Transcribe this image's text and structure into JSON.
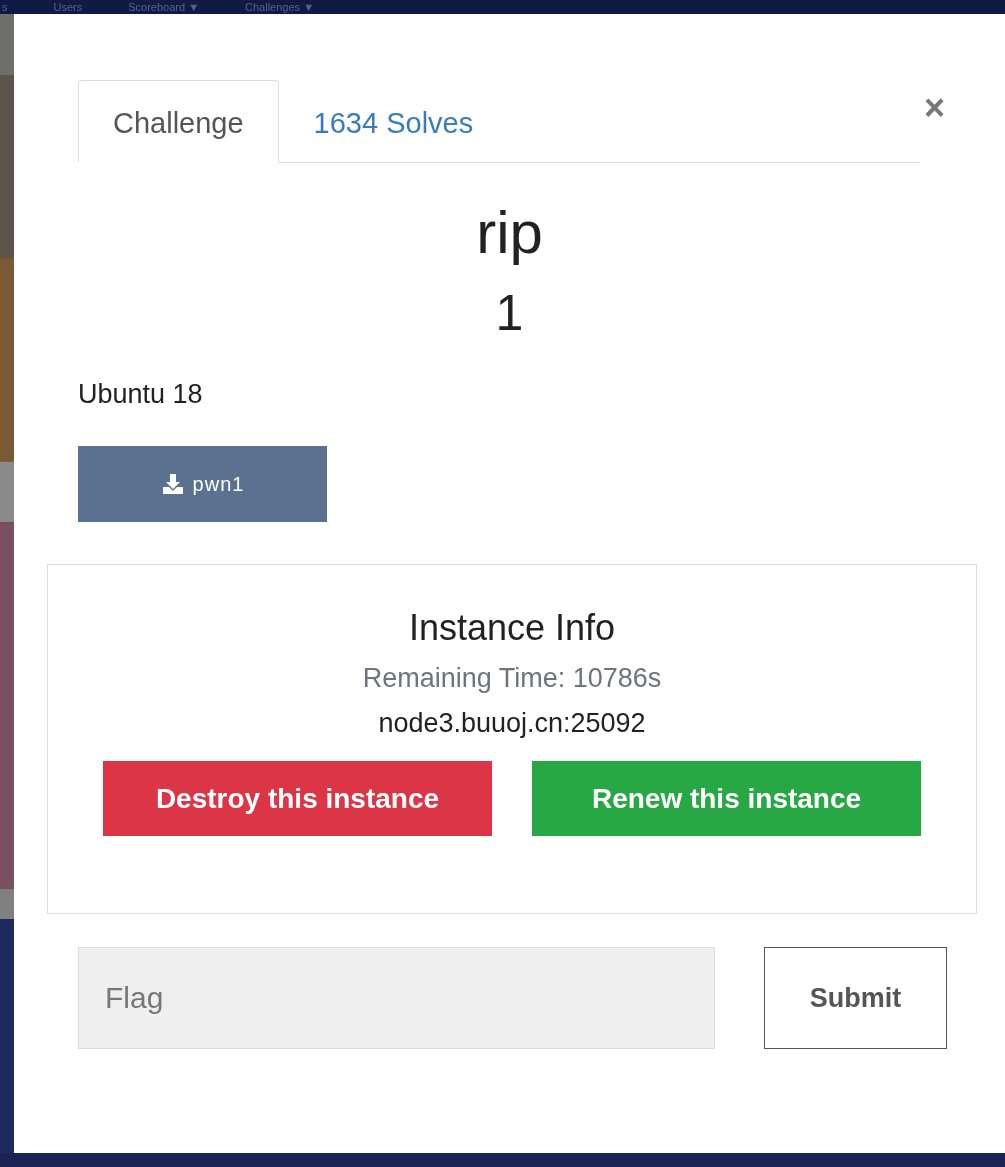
{
  "nav": {
    "items": [
      "s",
      "Users",
      "Scoreboard ▼",
      "Challenges ▼"
    ]
  },
  "tabs": [
    {
      "label": "Challenge",
      "selected": true
    },
    {
      "label": "1634 Solves",
      "selected": false
    }
  ],
  "close": "×",
  "challenge": {
    "name": "rip",
    "value": "1",
    "description": "Ubuntu 18",
    "files": [
      {
        "label": "pwn1"
      }
    ]
  },
  "instance": {
    "title": "Instance Info",
    "remaining": "Remaining Time: 10786s",
    "address": "node3.buuoj.cn:25092",
    "buttons": [
      {
        "label": "Destroy this instance",
        "kind": "danger"
      },
      {
        "label": "Renew this instance",
        "kind": "success"
      }
    ]
  },
  "flag": {
    "placeholder": "Flag",
    "submit": "Submit"
  }
}
